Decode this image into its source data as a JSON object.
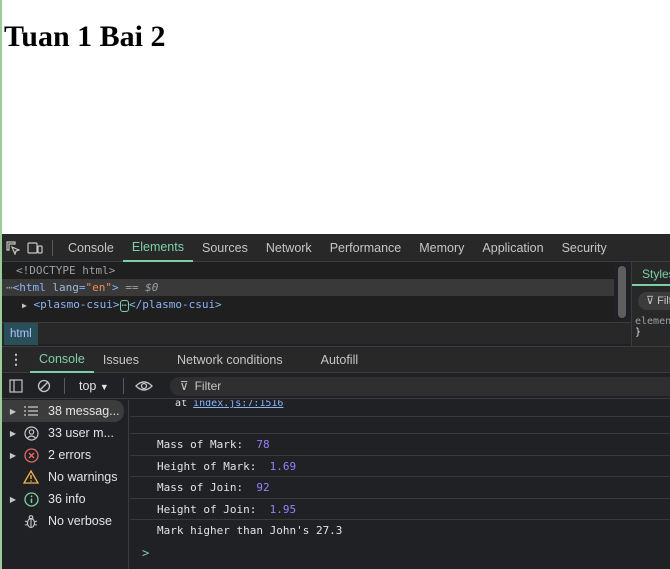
{
  "page": {
    "heading": "Tuan 1 Bai 2"
  },
  "devtools": {
    "main_tabs": [
      "Console",
      "Elements",
      "Sources",
      "Network",
      "Performance",
      "Memory",
      "Application",
      "Security"
    ],
    "active_tab": "Elements",
    "elements": {
      "doctype": "<!DOCTYPE html>",
      "html_open": "<html",
      "html_attr_name": "lang",
      "html_attr_value": "\"en\"",
      "html_close": ">",
      "selected_marker": "== $0",
      "child_tag_open": "<plasmo-csui>",
      "child_tag_close": "</plasmo-csui>",
      "ellipsis": "⋯"
    },
    "styles": {
      "tab": "Styles",
      "filter": "Filter",
      "element_text": "element",
      "brace": "}"
    },
    "breadcrumb": "html",
    "drawer_tabs": [
      "Console",
      "Issues",
      "Network conditions",
      "Autofill"
    ],
    "console_toolbar": {
      "context": "top",
      "filter_placeholder": "Filter"
    },
    "sidebar": [
      {
        "label": "38 messag...",
        "icon": "list-icon",
        "count": 38
      },
      {
        "label": "33 user m...",
        "icon": "user-icon",
        "count": 33
      },
      {
        "label": "2 errors",
        "icon": "error-icon",
        "count": 2
      },
      {
        "label": "No warnings",
        "icon": "warning-icon",
        "count": 0
      },
      {
        "label": "36 info",
        "icon": "info-icon",
        "count": 36
      },
      {
        "label": "No verbose",
        "icon": "bug-icon",
        "count": 0
      }
    ],
    "log": [
      {
        "label": "",
        "value": ""
      },
      {
        "label": "Mass of Mark:",
        "value": "78"
      },
      {
        "label": "Height of Mark:",
        "value": "1.69"
      },
      {
        "label": "Mass of Join:",
        "value": "92"
      },
      {
        "label": "Height of Join:",
        "value": "1.95"
      },
      {
        "label": "Mark higher than John's 27.3",
        "value": ""
      }
    ],
    "prompt": ">"
  },
  "colors": {
    "accent": "#7cd0a8",
    "number": "#9980ff",
    "error": "#e46962",
    "warning": "#f0b34d",
    "info": "#7cd0a8"
  }
}
